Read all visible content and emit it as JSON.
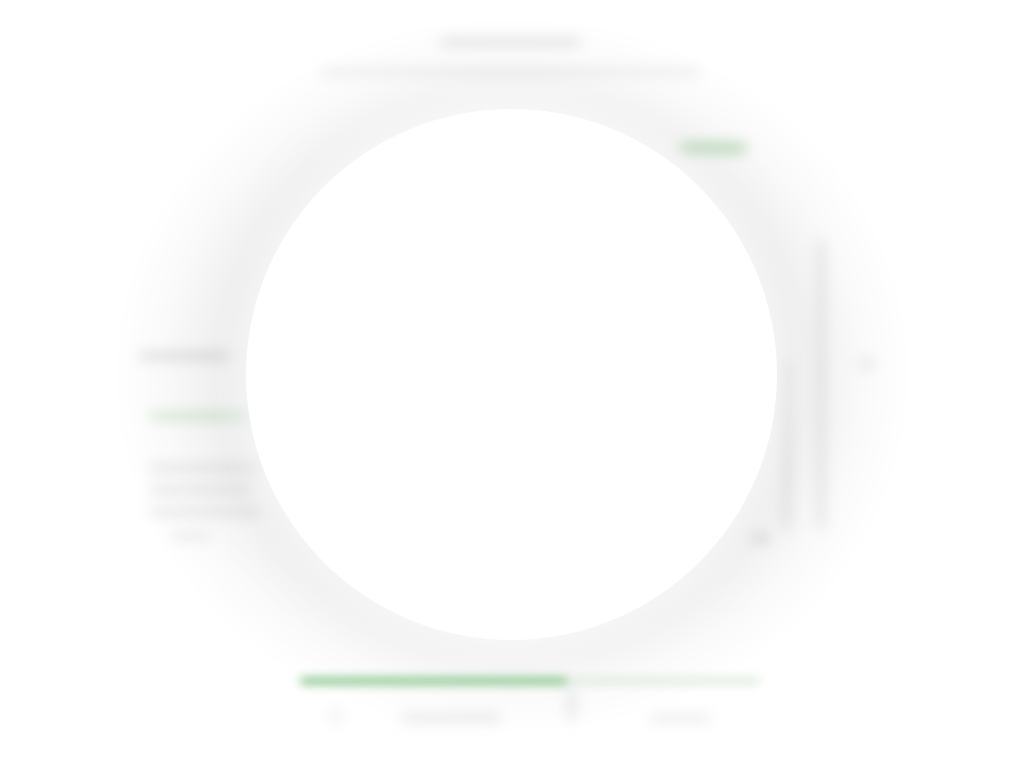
{
  "colors": {
    "accent": "#6ab76c",
    "text_muted": "#8c8c8c",
    "overlay": "#ffffff"
  },
  "loading": {
    "progress_fraction": 0.58
  }
}
